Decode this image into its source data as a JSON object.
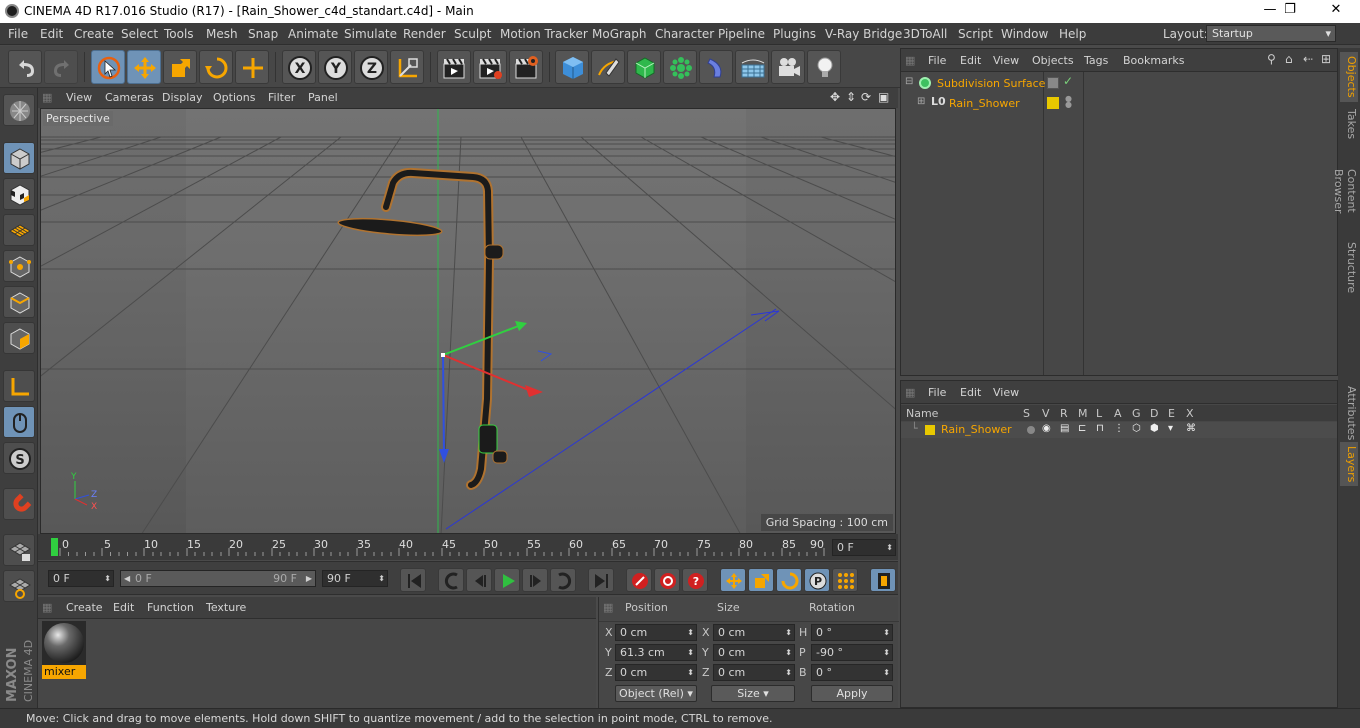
{
  "window": {
    "title": "CINEMA 4D R17.016 Studio (R17) - [Rain_Shower_c4d_standart.c4d] - Main",
    "minimize": "—",
    "maximize": "❐",
    "close": "✕"
  },
  "menu": {
    "items": [
      "File",
      "Edit",
      "Create",
      "Select",
      "Tools",
      "Mesh",
      "Snap",
      "Animate",
      "Simulate",
      "Render",
      "Sculpt",
      "Motion Tracker",
      "MoGraph",
      "Character",
      "Pipeline",
      "Plugins",
      "V-Ray Bridge",
      "3DToAll",
      "Script",
      "Window",
      "Help"
    ],
    "layout_label": "Layout:",
    "layout_value": "Startup"
  },
  "toolbar": {
    "axis_x": "X",
    "axis_y": "Y",
    "axis_z": "Z"
  },
  "viewport": {
    "menu": [
      "View",
      "Cameras",
      "Display",
      "Options",
      "Filter",
      "Panel"
    ],
    "label": "Perspective",
    "grid_spacing": "Grid Spacing : 100 cm",
    "axis_y": "Y",
    "axis_z": "Z",
    "axis_x": "X"
  },
  "timeline": {
    "ticks": [
      "0",
      "5",
      "10",
      "15",
      "20",
      "25",
      "30",
      "35",
      "40",
      "45",
      "50",
      "55",
      "60",
      "65",
      "70",
      "75",
      "80",
      "85",
      "90"
    ],
    "current_frame": "0 F"
  },
  "transport": {
    "start_field": "0 F",
    "range_start": "0 F",
    "range_end": "90 F",
    "end_field": "90 F"
  },
  "material_manager": {
    "menu": [
      "Create",
      "Edit",
      "Function",
      "Texture"
    ],
    "materials": [
      {
        "name": "mixer"
      }
    ]
  },
  "coordinates": {
    "headers": {
      "position": "Position",
      "size": "Size",
      "rotation": "Rotation"
    },
    "rows": [
      {
        "axis": "X",
        "pos": "0 cm",
        "size_axis": "X",
        "size": "0 cm",
        "rot_axis": "H",
        "rot": "0 °"
      },
      {
        "axis": "Y",
        "pos": "61.3 cm",
        "size_axis": "Y",
        "size": "0 cm",
        "rot_axis": "P",
        "rot": "-90 °"
      },
      {
        "axis": "Z",
        "pos": "0 cm",
        "size_axis": "Z",
        "size": "0 cm",
        "rot_axis": "B",
        "rot": "0 °"
      }
    ],
    "mode_select": "Object (Rel)",
    "size_select": "Size",
    "apply": "Apply"
  },
  "object_manager": {
    "menu": [
      "File",
      "Edit",
      "View",
      "Objects",
      "Tags",
      "Bookmarks"
    ],
    "objects": [
      {
        "name": "Subdivision Surface"
      },
      {
        "name": "Rain_Shower"
      }
    ]
  },
  "layer_manager": {
    "menu": [
      "File",
      "Edit",
      "View"
    ],
    "columns": [
      "Name",
      "S",
      "V",
      "R",
      "M",
      "L",
      "A",
      "G",
      "D",
      "E",
      "X"
    ],
    "layers": [
      {
        "name": "Rain_Shower",
        "color": "#e8c800"
      }
    ]
  },
  "right_tabs": [
    "Objects",
    "Takes",
    "Content Browser",
    "Structure",
    "Attributes",
    "Layers"
  ],
  "status": {
    "text": "Move: Click and drag to move elements. Hold down SHIFT to quantize movement / add to the selection in point mode, CTRL to remove."
  },
  "colors": {
    "accent": "#6f93b7",
    "highlight": "#f7a600",
    "x_axis": "#e03030",
    "y_axis": "#30c030",
    "z_axis": "#3050e0"
  }
}
